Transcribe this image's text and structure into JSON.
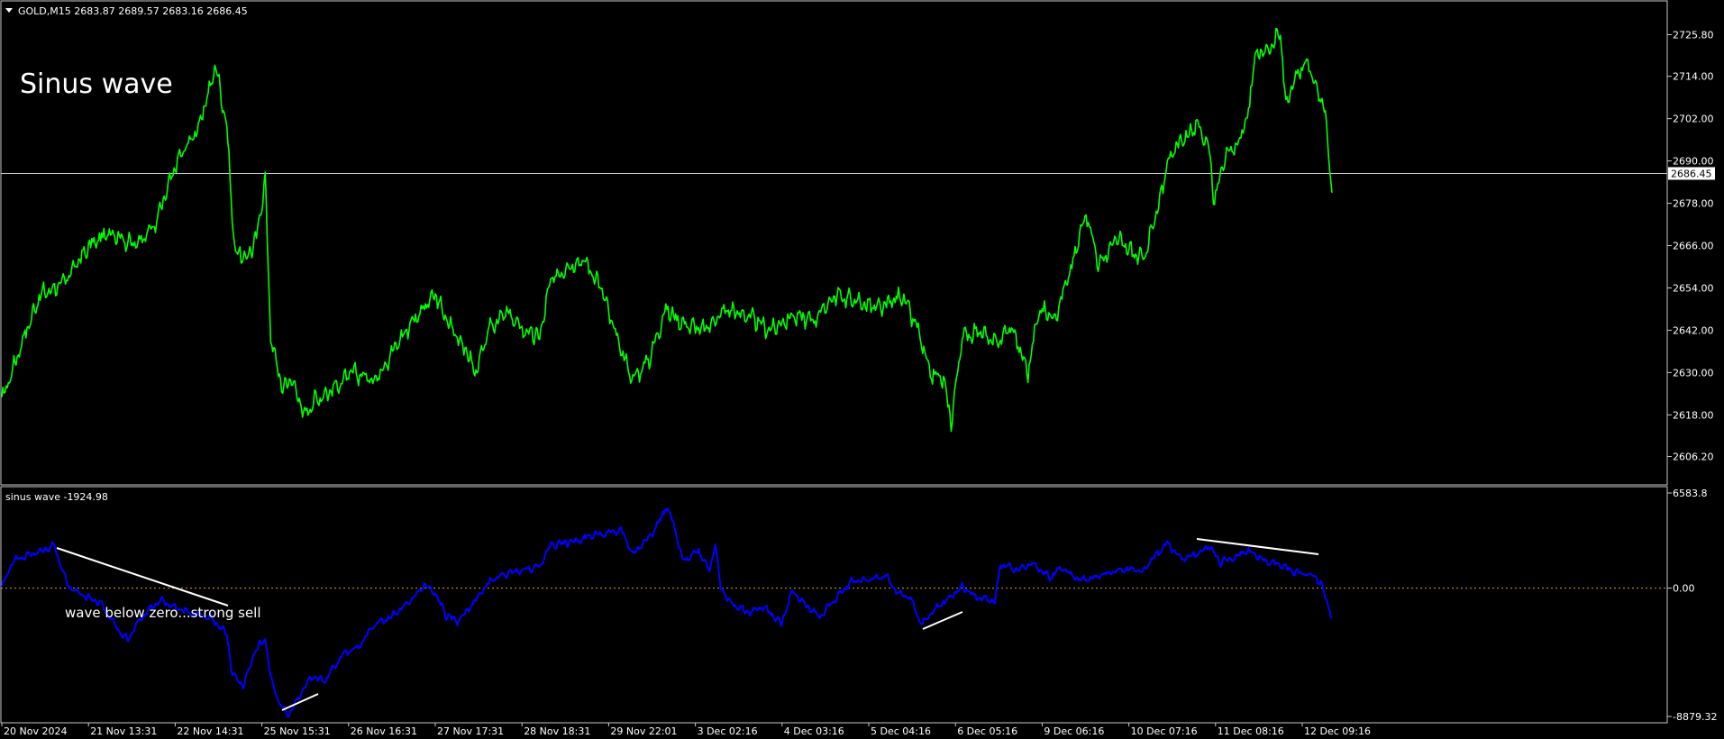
{
  "colors": {
    "background": "#000000",
    "frame": "#c8c8c8",
    "price_line": "#00ff00",
    "indicator_line": "#0000ff",
    "zero_line": "#d4a017",
    "annotation": "#ffffff",
    "current_price_box": "#ffffff",
    "axis_text": "#ffffff"
  },
  "main_chart": {
    "symbol_header": "GOLD,M15  2683.87 2689.57 2683.16 2686.45",
    "title_text": "Sinus wave",
    "current_price_label": "2686.45"
  },
  "indicator": {
    "header": "sinus wave -1924.98",
    "annotation": "wave below zero...strong sell"
  },
  "chart_data": [
    {
      "type": "line",
      "name": "GOLD,M15",
      "ylim": [
        2600.2,
        2731.8
      ],
      "y_ticks": [
        "2725.80",
        "2714.00",
        "2702.00",
        "2690.00",
        "2678.00",
        "2666.00",
        "2654.00",
        "2642.00",
        "2630.00",
        "2618.00",
        "2606.20"
      ],
      "y_tick_values": [
        2725.8,
        2714.0,
        2702.0,
        2690.0,
        2678.0,
        2666.0,
        2654.0,
        2642.0,
        2630.0,
        2618.0,
        2606.2
      ],
      "x_ticks": [
        "20 Nov 2024",
        "21 Nov 13:31",
        "22 Nov 14:31",
        "25 Nov 15:31",
        "26 Nov 16:31",
        "27 Nov 17:31",
        "28 Nov 18:31",
        "29 Nov 22:01",
        "3 Dec 02:16",
        "4 Dec 03:16",
        "5 Dec 04:16",
        "6 Dec 05:16",
        "9 Dec 06:16",
        "10 Dec 07:16",
        "11 Dec 08:16",
        "12 Dec 09:16"
      ],
      "current_price": 2686.45,
      "anchors": [
        [
          0,
          2622
        ],
        [
          20,
          2640
        ],
        [
          35,
          2652
        ],
        [
          55,
          2655
        ],
        [
          80,
          2666
        ],
        [
          100,
          2670
        ],
        [
          120,
          2666
        ],
        [
          140,
          2672
        ],
        [
          160,
          2690
        ],
        [
          180,
          2700
        ],
        [
          195,
          2717
        ],
        [
          205,
          2700
        ],
        [
          212,
          2665
        ],
        [
          222,
          2662
        ],
        [
          232,
          2668
        ],
        [
          240,
          2685
        ],
        [
          245,
          2640
        ],
        [
          255,
          2626
        ],
        [
          265,
          2628
        ],
        [
          275,
          2618
        ],
        [
          285,
          2622
        ],
        [
          300,
          2625
        ],
        [
          320,
          2630
        ],
        [
          340,
          2628
        ],
        [
          360,
          2638
        ],
        [
          375,
          2645
        ],
        [
          395,
          2652
        ],
        [
          405,
          2645
        ],
        [
          420,
          2638
        ],
        [
          432,
          2630
        ],
        [
          445,
          2643
        ],
        [
          460,
          2647
        ],
        [
          475,
          2642
        ],
        [
          490,
          2640
        ],
        [
          500,
          2656
        ],
        [
          515,
          2660
        ],
        [
          530,
          2662
        ],
        [
          545,
          2655
        ],
        [
          560,
          2640
        ],
        [
          575,
          2628
        ],
        [
          590,
          2634
        ],
        [
          605,
          2648
        ],
        [
          620,
          2644
        ],
        [
          640,
          2642
        ],
        [
          660,
          2648
        ],
        [
          680,
          2646
        ],
        [
          700,
          2642
        ],
        [
          720,
          2646
        ],
        [
          740,
          2645
        ],
        [
          760,
          2652
        ],
        [
          780,
          2650
        ],
        [
          800,
          2648
        ],
        [
          820,
          2652
        ],
        [
          835,
          2642
        ],
        [
          845,
          2630
        ],
        [
          858,
          2628
        ],
        [
          865,
          2616
        ],
        [
          875,
          2640
        ],
        [
          890,
          2642
        ],
        [
          905,
          2638
        ],
        [
          920,
          2643
        ],
        [
          935,
          2630
        ],
        [
          945,
          2648
        ],
        [
          960,
          2646
        ],
        [
          975,
          2660
        ],
        [
          988,
          2676
        ],
        [
          1000,
          2660
        ],
        [
          1015,
          2668
        ],
        [
          1030,
          2664
        ],
        [
          1040,
          2662
        ],
        [
          1055,
          2678
        ],
        [
          1062,
          2690
        ],
        [
          1075,
          2696
        ],
        [
          1090,
          2700
        ],
        [
          1100,
          2694
        ],
        [
          1105,
          2678
        ],
        [
          1112,
          2690
        ],
        [
          1125,
          2694
        ],
        [
          1135,
          2702
        ],
        [
          1142,
          2720
        ],
        [
          1155,
          2722
        ],
        [
          1165,
          2726
        ],
        [
          1170,
          2706
        ],
        [
          1180,
          2714
        ],
        [
          1190,
          2718
        ],
        [
          1198,
          2711
        ],
        [
          1206,
          2704
        ],
        [
          1212,
          2681
        ]
      ]
    },
    {
      "type": "line",
      "name": "sinus wave",
      "ylim": [
        -8879.32,
        6583.8
      ],
      "y_ticks": [
        "6583.8",
        "0.00",
        "-8879.32"
      ],
      "y_tick_values": [
        6583.8,
        0.0,
        -8879.32
      ],
      "zero_line": 0.0,
      "anchors": [
        [
          0,
          0
        ],
        [
          10,
          1900
        ],
        [
          25,
          2300
        ],
        [
          48,
          2900
        ],
        [
          60,
          200
        ],
        [
          75,
          -600
        ],
        [
          90,
          -1000
        ],
        [
          105,
          -2800
        ],
        [
          115,
          -3600
        ],
        [
          125,
          -2200
        ],
        [
          135,
          -1400
        ],
        [
          145,
          -900
        ],
        [
          160,
          -1400
        ],
        [
          175,
          -1800
        ],
        [
          190,
          -2000
        ],
        [
          205,
          -3200
        ],
        [
          210,
          -6000
        ],
        [
          220,
          -6800
        ],
        [
          230,
          -4500
        ],
        [
          240,
          -3400
        ],
        [
          245,
          -6300
        ],
        [
          255,
          -8300
        ],
        [
          262,
          -8700
        ],
        [
          272,
          -7300
        ],
        [
          282,
          -6100
        ],
        [
          295,
          -6400
        ],
        [
          310,
          -4600
        ],
        [
          325,
          -4100
        ],
        [
          340,
          -2500
        ],
        [
          355,
          -2000
        ],
        [
          370,
          -1100
        ],
        [
          385,
          200
        ],
        [
          395,
          -400
        ],
        [
          405,
          -1900
        ],
        [
          415,
          -2300
        ],
        [
          430,
          -1000
        ],
        [
          445,
          500
        ],
        [
          460,
          1000
        ],
        [
          475,
          1300
        ],
        [
          490,
          1500
        ],
        [
          500,
          3000
        ],
        [
          520,
          3200
        ],
        [
          540,
          3700
        ],
        [
          555,
          3800
        ],
        [
          565,
          4000
        ],
        [
          575,
          2300
        ],
        [
          585,
          3200
        ],
        [
          595,
          4000
        ],
        [
          605,
          5600
        ],
        [
          612,
          4500
        ],
        [
          620,
          1900
        ],
        [
          635,
          2600
        ],
        [
          645,
          1200
        ],
        [
          650,
          3200
        ],
        [
          655,
          0
        ],
        [
          665,
          -1100
        ],
        [
          680,
          -1700
        ],
        [
          695,
          -1300
        ],
        [
          710,
          -2500
        ],
        [
          720,
          -200
        ],
        [
          735,
          -1300
        ],
        [
          745,
          -2000
        ],
        [
          760,
          -700
        ],
        [
          775,
          500
        ],
        [
          795,
          600
        ],
        [
          805,
          900
        ],
        [
          815,
          -300
        ],
        [
          828,
          -700
        ],
        [
          838,
          -2500
        ],
        [
          850,
          -1500
        ],
        [
          865,
          -600
        ],
        [
          875,
          100
        ],
        [
          890,
          -700
        ],
        [
          905,
          -900
        ],
        [
          910,
          1600
        ],
        [
          925,
          1300
        ],
        [
          940,
          1700
        ],
        [
          955,
          700
        ],
        [
          965,
          1400
        ],
        [
          980,
          600
        ],
        [
          995,
          700
        ],
        [
          1010,
          1100
        ],
        [
          1025,
          1300
        ],
        [
          1040,
          1200
        ],
        [
          1055,
          2600
        ],
        [
          1062,
          3100
        ],
        [
          1075,
          2000
        ],
        [
          1090,
          2400
        ],
        [
          1100,
          3000
        ],
        [
          1110,
          1800
        ],
        [
          1120,
          2000
        ],
        [
          1135,
          2600
        ],
        [
          1150,
          1900
        ],
        [
          1165,
          1600
        ],
        [
          1175,
          1200
        ],
        [
          1185,
          1000
        ],
        [
          1195,
          900
        ],
        [
          1202,
          300
        ],
        [
          1212,
          -2000
        ]
      ]
    }
  ],
  "drawings": {
    "trendlines_label": "white trendlines"
  }
}
